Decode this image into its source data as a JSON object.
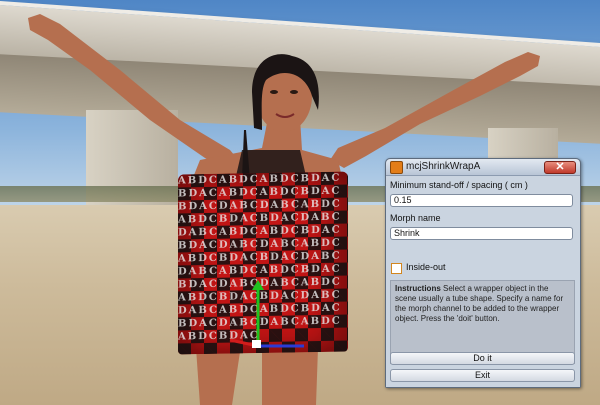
{
  "dialog": {
    "title": "mcjShrinkWrapA",
    "close_icon_glyph": "✕",
    "standoff_label": "Minimum stand-off / spacing ( cm )",
    "standoff_value": "0.15",
    "morph_label": "Morph name",
    "morph_value": "Shrink",
    "inside_out_label": "Inside-out",
    "inside_out_checked": false,
    "instructions_heading": "Instructions",
    "instructions_text": "Select a wrapper object in the scene usually a tube shape. Specify a name for the morph channel to be added to the wrapper object. Press the 'doit' button.",
    "doit_label": "Do it",
    "exit_label": "Exit"
  },
  "scene": {
    "wrap_letters": "ABDCABDCABDCBDACBDACABDCABDCBDACBDACDABCDABCABDCABDCBDACBDACDABCDABCABDCABDCBDACBDACDABCDABCABDCABDCBDACBDACDABCDABCABDCABDCBDACBDACDABCDABCABDCABDCBDACBDACDABCDABCABDCABDCBDACBDACDABCDABCABDCABDCBDAC",
    "colors": {
      "wrap_red": "#c21515",
      "skin": "#b56f4f",
      "hair": "#1b1414"
    }
  }
}
